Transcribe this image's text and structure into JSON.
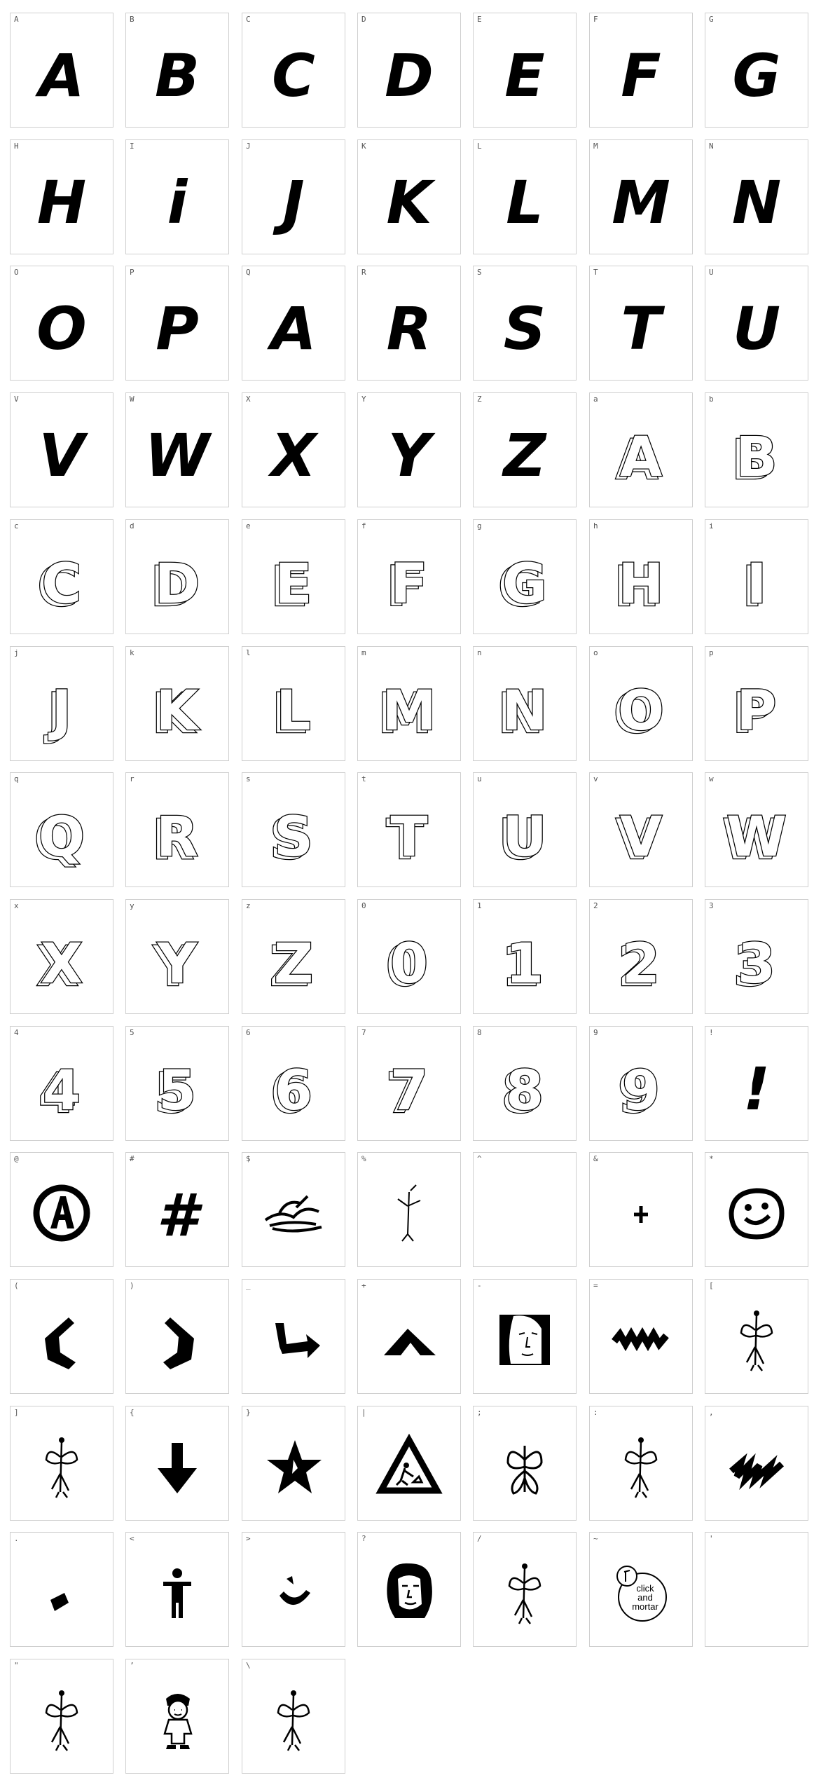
{
  "font_map": {
    "cells": [
      {
        "label": "A",
        "glyph": "A",
        "style": "solid",
        "icon": "letter-a-solid-icon"
      },
      {
        "label": "B",
        "glyph": "B",
        "style": "solid",
        "icon": "letter-b-solid-icon"
      },
      {
        "label": "C",
        "glyph": "C",
        "style": "solid",
        "icon": "letter-c-solid-icon"
      },
      {
        "label": "D",
        "glyph": "D",
        "style": "solid",
        "icon": "letter-d-solid-icon"
      },
      {
        "label": "E",
        "glyph": "E",
        "style": "solid",
        "icon": "letter-e-solid-icon"
      },
      {
        "label": "F",
        "glyph": "F",
        "style": "solid",
        "icon": "letter-f-solid-icon"
      },
      {
        "label": "G",
        "glyph": "G",
        "style": "solid",
        "icon": "letter-g-solid-icon"
      },
      {
        "label": "H",
        "glyph": "H",
        "style": "solid",
        "icon": "letter-h-solid-icon"
      },
      {
        "label": "I",
        "glyph": "i",
        "style": "solid",
        "icon": "letter-i-solid-icon"
      },
      {
        "label": "J",
        "glyph": "J",
        "style": "solid",
        "icon": "letter-j-solid-icon"
      },
      {
        "label": "K",
        "glyph": "K",
        "style": "solid",
        "icon": "letter-k-solid-icon"
      },
      {
        "label": "L",
        "glyph": "L",
        "style": "solid",
        "icon": "letter-l-solid-icon"
      },
      {
        "label": "M",
        "glyph": "M",
        "style": "solid",
        "icon": "letter-m-solid-icon"
      },
      {
        "label": "N",
        "glyph": "N",
        "style": "solid",
        "icon": "letter-n-solid-icon"
      },
      {
        "label": "O",
        "glyph": "O",
        "style": "solid",
        "icon": "letter-o-solid-icon"
      },
      {
        "label": "P",
        "glyph": "P",
        "style": "solid",
        "icon": "letter-p-solid-icon"
      },
      {
        "label": "Q",
        "glyph": "A",
        "style": "solid",
        "icon": "letter-q-solid-icon"
      },
      {
        "label": "R",
        "glyph": "R",
        "style": "solid",
        "icon": "letter-r-solid-icon"
      },
      {
        "label": "S",
        "glyph": "S",
        "style": "solid",
        "icon": "letter-s-solid-icon"
      },
      {
        "label": "T",
        "glyph": "T",
        "style": "solid",
        "icon": "letter-t-solid-icon"
      },
      {
        "label": "U",
        "glyph": "U",
        "style": "solid",
        "icon": "letter-u-solid-icon"
      },
      {
        "label": "V",
        "glyph": "V",
        "style": "solid",
        "icon": "letter-v-solid-icon"
      },
      {
        "label": "W",
        "glyph": "W",
        "style": "solid",
        "icon": "letter-w-solid-icon"
      },
      {
        "label": "X",
        "glyph": "X",
        "style": "solid",
        "icon": "letter-x-solid-icon"
      },
      {
        "label": "Y",
        "glyph": "Y",
        "style": "solid",
        "icon": "letter-y-solid-icon"
      },
      {
        "label": "Z",
        "glyph": "Z",
        "style": "solid",
        "icon": "letter-z-solid-icon"
      },
      {
        "label": "a",
        "glyph": "A",
        "style": "outline",
        "icon": "letter-a-3d-outline-icon"
      },
      {
        "label": "b",
        "glyph": "B",
        "style": "outline",
        "icon": "letter-b-3d-outline-icon"
      },
      {
        "label": "c",
        "glyph": "C",
        "style": "outline",
        "icon": "letter-c-3d-outline-icon"
      },
      {
        "label": "d",
        "glyph": "D",
        "style": "outline",
        "icon": "letter-d-3d-outline-icon"
      },
      {
        "label": "e",
        "glyph": "E",
        "style": "outline",
        "icon": "letter-e-3d-outline-icon"
      },
      {
        "label": "f",
        "glyph": "F",
        "style": "outline",
        "icon": "letter-f-3d-outline-icon"
      },
      {
        "label": "g",
        "glyph": "G",
        "style": "outline",
        "icon": "letter-g-3d-outline-icon"
      },
      {
        "label": "h",
        "glyph": "H",
        "style": "outline",
        "icon": "letter-h-3d-outline-icon"
      },
      {
        "label": "i",
        "glyph": "I",
        "style": "outline",
        "icon": "letter-i-3d-outline-icon"
      },
      {
        "label": "j",
        "glyph": "J",
        "style": "outline",
        "icon": "letter-j-3d-outline-icon"
      },
      {
        "label": "k",
        "glyph": "K",
        "style": "outline",
        "icon": "letter-k-3d-outline-icon"
      },
      {
        "label": "l",
        "glyph": "L",
        "style": "outline",
        "icon": "letter-l-3d-outline-icon"
      },
      {
        "label": "m",
        "glyph": "M",
        "style": "outline",
        "icon": "letter-m-3d-outline-icon"
      },
      {
        "label": "n",
        "glyph": "N",
        "style": "outline",
        "icon": "letter-n-3d-outline-icon"
      },
      {
        "label": "o",
        "glyph": "O",
        "style": "outline",
        "icon": "letter-o-3d-outline-icon"
      },
      {
        "label": "p",
        "glyph": "P",
        "style": "outline",
        "icon": "letter-p-3d-outline-icon"
      },
      {
        "label": "q",
        "glyph": "Q",
        "style": "outline",
        "icon": "letter-q-3d-outline-icon"
      },
      {
        "label": "r",
        "glyph": "R",
        "style": "outline",
        "icon": "letter-r-3d-outline-icon"
      },
      {
        "label": "s",
        "glyph": "S",
        "style": "outline",
        "icon": "letter-s-3d-outline-icon"
      },
      {
        "label": "t",
        "glyph": "T",
        "style": "outline",
        "icon": "letter-t-3d-outline-icon"
      },
      {
        "label": "u",
        "glyph": "U",
        "style": "outline",
        "icon": "letter-u-3d-outline-icon"
      },
      {
        "label": "v",
        "glyph": "V",
        "style": "outline",
        "icon": "letter-v-3d-outline-icon"
      },
      {
        "label": "w",
        "glyph": "W",
        "style": "outline",
        "icon": "letter-w-3d-outline-icon"
      },
      {
        "label": "x",
        "glyph": "X",
        "style": "outline",
        "icon": "letter-x-3d-outline-icon"
      },
      {
        "label": "y",
        "glyph": "Y",
        "style": "outline",
        "icon": "letter-y-3d-outline-icon"
      },
      {
        "label": "z",
        "glyph": "Z",
        "style": "outline",
        "icon": "letter-z-3d-outline-icon"
      },
      {
        "label": "0",
        "glyph": "0",
        "style": "outline",
        "icon": "digit-0-3d-outline-icon"
      },
      {
        "label": "1",
        "glyph": "1",
        "style": "outline",
        "icon": "digit-1-3d-outline-icon"
      },
      {
        "label": "2",
        "glyph": "2",
        "style": "outline",
        "icon": "digit-2-3d-outline-icon"
      },
      {
        "label": "3",
        "glyph": "3",
        "style": "outline",
        "icon": "digit-3-3d-outline-icon"
      },
      {
        "label": "4",
        "glyph": "4",
        "style": "outline",
        "icon": "digit-4-3d-outline-icon"
      },
      {
        "label": "5",
        "glyph": "5",
        "style": "outline",
        "icon": "digit-5-3d-outline-icon"
      },
      {
        "label": "6",
        "glyph": "6",
        "style": "outline",
        "icon": "digit-6-3d-outline-icon"
      },
      {
        "label": "7",
        "glyph": "7",
        "style": "outline",
        "icon": "digit-7-3d-outline-icon"
      },
      {
        "label": "8",
        "glyph": "8",
        "style": "outline",
        "icon": "digit-8-3d-outline-icon"
      },
      {
        "label": "9",
        "glyph": "9",
        "style": "outline",
        "icon": "digit-9-3d-outline-icon"
      },
      {
        "label": "!",
        "glyph": "!",
        "style": "solid",
        "icon": "exclamation-icon"
      },
      {
        "label": "@",
        "glyph": "",
        "style": "shape",
        "icon": "circled-a-icon"
      },
      {
        "label": "#",
        "glyph": "#",
        "style": "solid",
        "icon": "hash-icon"
      },
      {
        "label": "$",
        "glyph": "",
        "style": "shape",
        "icon": "scribble-creature-icon"
      },
      {
        "label": "%",
        "glyph": "",
        "style": "shape",
        "icon": "stick-figure-sketch-icon"
      },
      {
        "label": "^",
        "glyph": "",
        "style": "shape",
        "icon": "empty-glyph-icon"
      },
      {
        "label": "&",
        "glyph": "",
        "style": "shape",
        "icon": "small-cross-icon"
      },
      {
        "label": "*",
        "glyph": "",
        "style": "shape",
        "icon": "smiley-face-icon"
      },
      {
        "label": "(",
        "glyph": "",
        "style": "shape",
        "icon": "left-bracket-shape-icon"
      },
      {
        "label": ")",
        "glyph": "",
        "style": "shape",
        "icon": "right-bracket-shape-icon"
      },
      {
        "label": "_",
        "glyph": "",
        "style": "shape",
        "icon": "bent-arrow-icon"
      },
      {
        "label": "+",
        "glyph": "",
        "style": "shape",
        "icon": "mountain-peak-icon"
      },
      {
        "label": "-",
        "glyph": "",
        "style": "shape",
        "icon": "face-portrait-icon"
      },
      {
        "label": "=",
        "glyph": "",
        "style": "shape",
        "icon": "zigzag-stroke-icon"
      },
      {
        "label": "[",
        "glyph": "",
        "style": "shape",
        "icon": "fairy-sketch-icon"
      },
      {
        "label": "]",
        "glyph": "",
        "style": "shape",
        "icon": "fairy-sketch-icon"
      },
      {
        "label": "{",
        "glyph": "",
        "style": "shape",
        "icon": "down-arrow-icon"
      },
      {
        "label": "}",
        "glyph": "",
        "style": "shape",
        "icon": "star-icon"
      },
      {
        "label": "|",
        "glyph": "",
        "style": "shape",
        "icon": "road-works-sign-icon"
      },
      {
        "label": ";",
        "glyph": "",
        "style": "shape",
        "icon": "butterfly-fairy-icon"
      },
      {
        "label": ":",
        "glyph": "",
        "style": "shape",
        "icon": "fairy-sketch-icon"
      },
      {
        "label": ",",
        "glyph": "",
        "style": "shape",
        "icon": "scribble-smudge-icon"
      },
      {
        "label": ".",
        "glyph": "",
        "style": "shape",
        "icon": "dot-shape-icon"
      },
      {
        "label": "<",
        "glyph": "",
        "style": "shape",
        "icon": "person-figure-icon"
      },
      {
        "label": ">",
        "glyph": "",
        "style": "shape",
        "icon": "winking-face-icon"
      },
      {
        "label": "?",
        "glyph": "",
        "style": "shape",
        "icon": "face-portrait-dreadlocks-icon"
      },
      {
        "label": "/",
        "glyph": "",
        "style": "shape",
        "icon": "fairy-sketch-icon"
      },
      {
        "label": "~",
        "glyph": "",
        "style": "shape",
        "icon": "click-and-mortar-badge-icon",
        "text": [
          "click",
          "and",
          "mortar"
        ]
      },
      {
        "label": "'",
        "glyph": "",
        "style": "shape",
        "icon": "empty-glyph-icon"
      },
      {
        "label": "\"",
        "glyph": "",
        "style": "shape",
        "icon": "fairy-sketch-icon"
      },
      {
        "label": "’",
        "glyph": "",
        "style": "shape",
        "icon": "cartoon-boy-icon"
      },
      {
        "label": "\\",
        "glyph": "",
        "style": "shape",
        "icon": "fairy-sketch-icon"
      }
    ]
  }
}
